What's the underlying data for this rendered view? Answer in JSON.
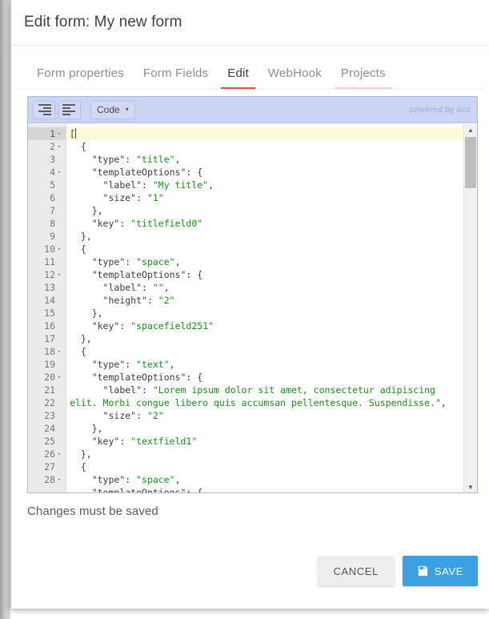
{
  "dialog": {
    "title": "Edit form: My new form",
    "status_text": "Changes must be saved"
  },
  "tabs": [
    {
      "label": "Form properties",
      "state": "inactive"
    },
    {
      "label": "Form Fields",
      "state": "inactive"
    },
    {
      "label": "Edit",
      "state": "active"
    },
    {
      "label": "WebHook",
      "state": "inactive"
    },
    {
      "label": "Projects",
      "state": "ripple"
    }
  ],
  "editor": {
    "toolbar": {
      "align_right_icon": "align-right-icon",
      "align_left_icon": "align-left-icon",
      "mode_label": "Code",
      "mode_caret": "▾",
      "credit": "powered by ace"
    },
    "scroll": {
      "up_arrow": "▲",
      "down_arrow": "▼"
    },
    "lines": [
      {
        "n": "1",
        "fold": "▾",
        "active": true,
        "code": "["
      },
      {
        "n": "2",
        "fold": "▾",
        "code": "  {"
      },
      {
        "n": "3",
        "fold": "",
        "code": "    \"type\": \"title\","
      },
      {
        "n": "4",
        "fold": "▾",
        "code": "    \"templateOptions\": {"
      },
      {
        "n": "5",
        "fold": "",
        "code": "      \"label\": \"My title\","
      },
      {
        "n": "6",
        "fold": "",
        "code": "      \"size\": \"1\""
      },
      {
        "n": "7",
        "fold": "",
        "code": "    },"
      },
      {
        "n": "8",
        "fold": "",
        "code": "    \"key\": \"titlefield0\""
      },
      {
        "n": "9",
        "fold": "",
        "code": "  },"
      },
      {
        "n": "10",
        "fold": "▾",
        "code": "  {"
      },
      {
        "n": "11",
        "fold": "",
        "code": "    \"type\": \"space\","
      },
      {
        "n": "12",
        "fold": "▾",
        "code": "    \"templateOptions\": {"
      },
      {
        "n": "13",
        "fold": "",
        "code": "      \"label\": \"\","
      },
      {
        "n": "14",
        "fold": "",
        "code": "      \"height\": \"2\""
      },
      {
        "n": "15",
        "fold": "",
        "code": "    },"
      },
      {
        "n": "16",
        "fold": "",
        "code": "    \"key\": \"spacefield251\""
      },
      {
        "n": "17",
        "fold": "",
        "code": "  },"
      },
      {
        "n": "18",
        "fold": "▾",
        "code": "  {"
      },
      {
        "n": "19",
        "fold": "",
        "code": "    \"type\": \"text\","
      },
      {
        "n": "20",
        "fold": "▾",
        "code": "    \"templateOptions\": {"
      },
      {
        "n": "21",
        "fold": "",
        "wrapped": true,
        "code": "      \"label\": \"Lorem ipsum dolor sit amet, consectetur adipiscing\nelit. Morbi congue libero quis accumsan pellentesque. Suspendisse.\","
      },
      {
        "n": "22",
        "fold": "",
        "code": "      \"size\": \"2\""
      },
      {
        "n": "23",
        "fold": "",
        "code": "    },"
      },
      {
        "n": "24",
        "fold": "",
        "code": "    \"key\": \"textfield1\""
      },
      {
        "n": "25",
        "fold": "",
        "code": "  },"
      },
      {
        "n": "26",
        "fold": "▾",
        "code": "  {"
      },
      {
        "n": "27",
        "fold": "",
        "code": "    \"type\": \"space\","
      },
      {
        "n": "28",
        "fold": "▾",
        "code": "    \"templateOptions\": {"
      }
    ]
  },
  "footer": {
    "cancel_label": "CANCEL",
    "save_label": "SAVE",
    "save_icon": "floppy-disk-icon"
  },
  "colors": {
    "accent_red": "#ef4b4f",
    "accent_red_faded": "#fbcfd2",
    "save_blue": "#3ba1e3",
    "editor_chrome": "#ccd4f3",
    "string_green": "#1a8f1a",
    "active_line": "#fbfbd7"
  }
}
